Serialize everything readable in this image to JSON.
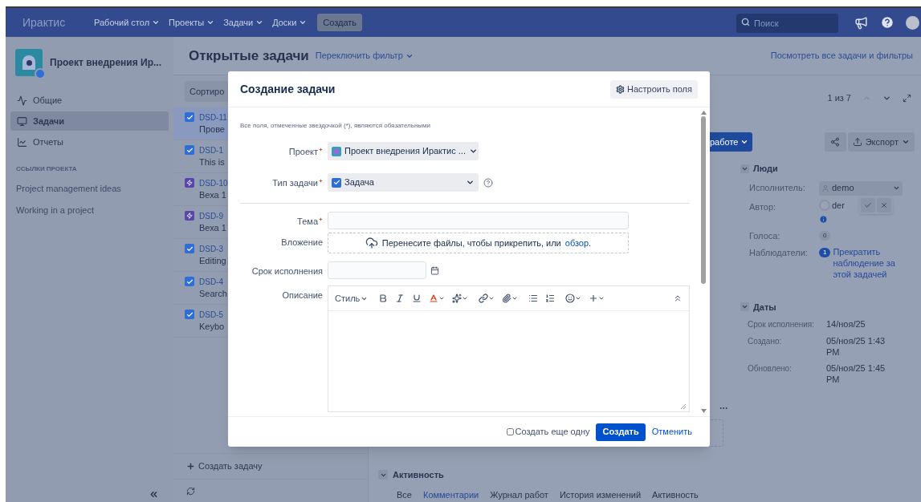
{
  "nav": {
    "logo": "Ирактис",
    "menus": [
      "Рабочий стол",
      "Проекты",
      "Задачи",
      "Доски"
    ],
    "create": "Создать",
    "search": {
      "placeholder": "Поиск"
    }
  },
  "sidebar": {
    "project": "Проект внедрения Ир...",
    "items": [
      {
        "label": "Общие",
        "selected": false
      },
      {
        "label": "Задачи",
        "selected": true
      },
      {
        "label": "Отчеты",
        "selected": false
      }
    ],
    "links_heading": "ССЫЛКИ ПРОЕКТА",
    "links": [
      "Project management ideas",
      "Working in a project"
    ]
  },
  "header": {
    "title": "Открытые задачи",
    "filter": "Переключить фильтр",
    "all_link": "Посмотреть все задачи и фильтры"
  },
  "list": {
    "sort": "Сортиро",
    "items": [
      {
        "key": "DSD-11",
        "summary": "Прове",
        "kind": "task",
        "selected": true
      },
      {
        "key": "DSD-1",
        "summary": "This is",
        "kind": "task",
        "selected": false
      },
      {
        "key": "DSD-10",
        "summary": "Веха 1",
        "kind": "milestone",
        "selected": false
      },
      {
        "key": "DSD-9",
        "summary": "Веха 1",
        "kind": "milestone",
        "selected": false
      },
      {
        "key": "DSD-3",
        "summary": "Editing",
        "kind": "task",
        "selected": false
      },
      {
        "key": "DSD-4",
        "summary": "Search",
        "kind": "task",
        "selected": false
      },
      {
        "key": "DSD-5",
        "summary": "Keybo",
        "kind": "task",
        "selected": false
      }
    ],
    "create": "Создать задачу"
  },
  "detail": {
    "pager": "1 из 7",
    "status_button": "работе",
    "export": "Экспорт",
    "people": {
      "title": "Люди",
      "assignee_label": "Исполнитель:",
      "assignee": "demo",
      "author_label": "Автор:",
      "author": "der",
      "votes_label": "Голоса:",
      "votes": "0",
      "watchers_label": "Наблюдатели:",
      "watchers": "1",
      "watch_link": "Прекратить наблюдение за этой задачей"
    },
    "dates": {
      "title": "Даты",
      "rows": [
        {
          "label": "Срок исполнения:",
          "value": "14/ноя/25"
        },
        {
          "label": "Создано:",
          "value": "05/ноя/25 1:43 PM"
        },
        {
          "label": "Обновлено:",
          "value": "05/ноя/25 1:45 PM"
        }
      ]
    },
    "activity": {
      "title": "Активность",
      "tabs": [
        {
          "label": "Все",
          "selected": false
        },
        {
          "label": "Комментарии",
          "selected": true
        },
        {
          "label": "Журнал работ",
          "selected": false
        },
        {
          "label": "История изменений",
          "selected": false
        },
        {
          "label": "Активность",
          "selected": false
        }
      ]
    }
  },
  "dialog": {
    "title": "Создание задачи",
    "configure": "Настроить поля",
    "note": "Все поля, отмеченные звездочкой (*), являются обязательными",
    "field_groups": [
      [
        {
          "kind": "select",
          "label": "Проект",
          "required": true,
          "value": "Проект внедрения Ирактис ..."
        },
        {
          "kind": "select",
          "label": "Тип задачи",
          "required": true,
          "value": "Задача",
          "help": true
        }
      ],
      [
        {
          "kind": "text",
          "label": "Тема",
          "required": true
        },
        {
          "kind": "attachment",
          "label": "Вложение",
          "required": false,
          "text": "Перенесите файлы, чтобы прикрепить, или",
          "link": "обзор."
        },
        {
          "kind": "date",
          "label": "Срок исполнения",
          "required": false
        },
        {
          "kind": "editor",
          "label": "Описание",
          "required": false,
          "style": "Стиль"
        }
      ]
    ],
    "create_another": {
      "label": "Создать еще одну",
      "checked": false
    },
    "submit": "Создать",
    "cancel": "Отменить"
  }
}
